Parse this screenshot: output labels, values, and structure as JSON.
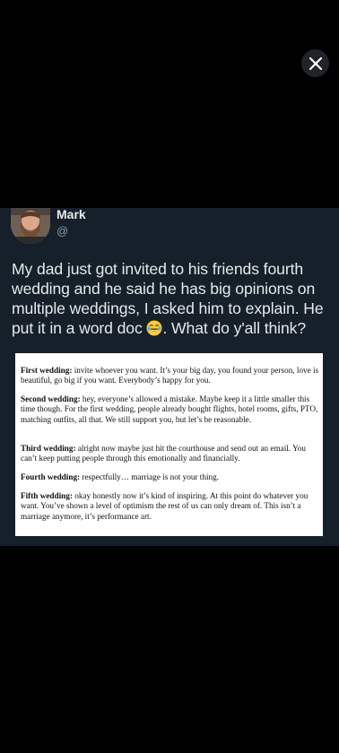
{
  "viewer": {
    "close_label": "Close",
    "close_icon": "close-icon"
  },
  "post": {
    "author": {
      "display_name": "Mark",
      "handle": "@"
    },
    "text_before_emoji": "My dad just got invited to his friends fourth wedding and he said he has big opinions on multiple weddings, I asked him to explain. He put it in a word doc ",
    "emoji": "face-with-tears-of-joy",
    "text_after_emoji": ". What do y'all think?",
    "document": {
      "paragraphs": [
        {
          "heading": "First wedding:",
          "body": " invite whoever you want. It’s your big day, you found your person, love is beautiful, go big if you want. Everybody’s happy for you."
        },
        {
          "heading": "Second wedding:",
          "body": " hey, everyone’s allowed a mistake. Maybe keep it a little smaller this time though. For the first wedding, people already bought flights, hotel rooms, gifts, PTO, matching outfits, all that. We still support you, but let’s be reasonable."
        },
        {
          "heading": "Third wedding:",
          "body": " alright now maybe just hit the courthouse and send out an email. You can’t keep putting people through this emotionally and financially."
        },
        {
          "heading": "Fourth wedding:",
          "body": " respectfully… marriage is not your thing."
        },
        {
          "heading": "Fifth wedding:",
          "body": " okay honestly now it’s kind of inspiring. At this point do whatever you want. You’ve shown a level of optimism the rest of us can only dream of. This isn’t a marriage anymore, it’s performance art."
        }
      ]
    }
  },
  "colors": {
    "background": "#000000",
    "post_background": "#15202b",
    "primary_text": "#e7e9ea",
    "secondary_text": "#8b98a5",
    "close_button": "#202327"
  }
}
